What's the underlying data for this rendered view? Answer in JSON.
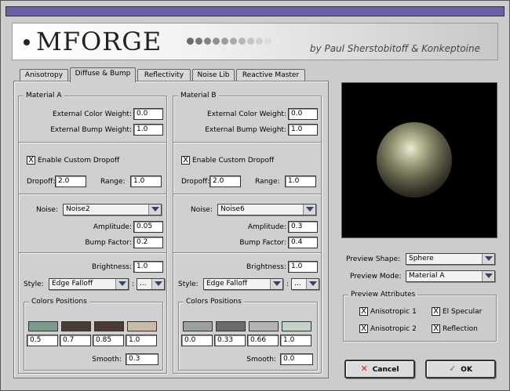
{
  "banner": {
    "logo": "MFORGE",
    "credit": "by Paul Sherstobitoff & Konkeptoine"
  },
  "tabs": [
    {
      "label": "Anisotropy"
    },
    {
      "label": "Diffuse & Bump"
    },
    {
      "label": "Reflectivity"
    },
    {
      "label": "Noise Lib"
    },
    {
      "label": "Reactive Master"
    }
  ],
  "materials": [
    {
      "title": "Material A",
      "ext_color_weight_label": "External Color Weight:",
      "ext_color_weight": "0.0",
      "ext_bump_weight_label": "External Bump Weight:",
      "ext_bump_weight": "1.0",
      "custom_dropoff_label": "Enable Custom Dropoff",
      "custom_dropoff_checked": true,
      "dropoff_label": "Dropoff:",
      "dropoff": "2.0",
      "range_label": "Range:",
      "range": "1.0",
      "noise_label": "Noise:",
      "noise": "Noise2",
      "amplitude_label": "Amplitude:",
      "amplitude": "0.05",
      "bump_factor_label": "Bump Factor:",
      "bump_factor": "0.2",
      "brightness_label": "Brightness:",
      "brightness": "1.0",
      "style_label": "Style:",
      "style": "Edge Falloff",
      "style_extra": "...",
      "colors_title": "Colors Positions",
      "colors": [
        "#7b9b8b",
        "#4a3b36",
        "#4d3a35",
        "#c9bba8"
      ],
      "positions": [
        "0.5",
        "0.7",
        "0.85",
        "1.0"
      ],
      "smooth_label": "Smooth:",
      "smooth": "0.3"
    },
    {
      "title": "Material B",
      "ext_color_weight_label": "External Color Weight:",
      "ext_color_weight": "0.0",
      "ext_bump_weight_label": "External Bump Weight:",
      "ext_bump_weight": "1.0",
      "custom_dropoff_label": "Enable Custom Dropoff",
      "custom_dropoff_checked": true,
      "dropoff_label": "Dropoff:",
      "dropoff": "2.0",
      "range_label": "Range:",
      "range": "1.0",
      "noise_label": "Noise:",
      "noise": "Noise6",
      "amplitude_label": "Amplitude:",
      "amplitude": "0.3",
      "bump_factor_label": "Bump Factor:",
      "bump_factor": "0.4",
      "brightness_label": "Brightness:",
      "brightness": "1.0",
      "style_label": "Style:",
      "style": "Edge Falloff",
      "style_extra": "...",
      "colors_title": "Colors Positions",
      "colors": [
        "#9aa09e",
        "#6b6b6b",
        "#b4b4b4",
        "#c3d3c8"
      ],
      "positions": [
        "0.0",
        "0.33",
        "0.66",
        "1.0"
      ],
      "smooth_label": "Smooth:",
      "smooth": "0.0"
    }
  ],
  "preview": {
    "shape_label": "Preview Shape:",
    "shape": "Sphere",
    "mode_label": "Preview Mode:",
    "mode": "Material A",
    "attributes_title": "Preview Attributes",
    "anisotropic1": "Anisotropic 1",
    "anisotropic2": "Anisotropic 2",
    "el_specular": "El Specular",
    "reflection": "Reflection"
  },
  "buttons": {
    "cancel": "Cancel",
    "ok": "OK"
  },
  "check_mark": "X",
  "colors": {
    "titlebar": "#6b5fa6",
    "cancel_icon": "#cc2222",
    "ok_icon": "#2a8a2a"
  },
  "icons": {
    "cancel": "x-icon",
    "ok": "check-icon",
    "dropdown": "chevron-down-icon"
  }
}
